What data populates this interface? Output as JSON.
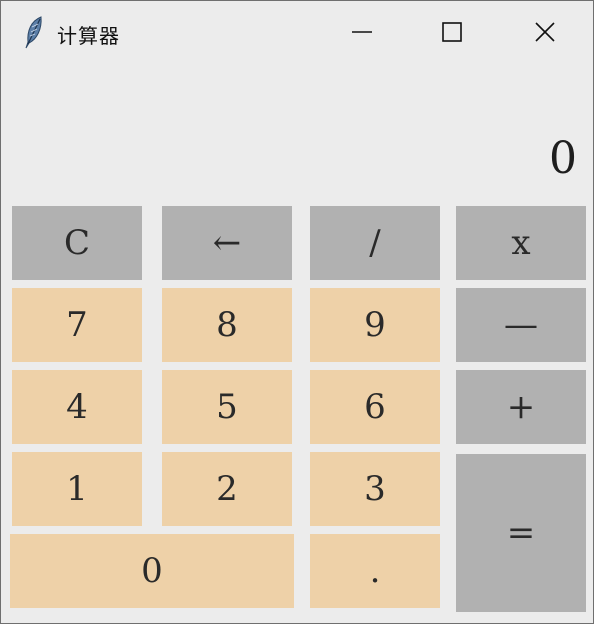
{
  "window": {
    "title": "计算器",
    "app_icon": "feather-icon",
    "controls": {
      "minimize": "minimize-icon",
      "maximize": "maximize-icon",
      "close": "close-icon"
    }
  },
  "display": {
    "value": "0"
  },
  "keys": {
    "clear": "C",
    "backspace": "←",
    "divide": "/",
    "multiply": "x",
    "seven": "7",
    "eight": "8",
    "nine": "9",
    "minus": "—",
    "four": "4",
    "five": "5",
    "six": "6",
    "plus": "+",
    "one": "1",
    "two": "2",
    "three": "3",
    "equals": "=",
    "zero": "0",
    "dot": "."
  },
  "colors": {
    "operator_key": "#b1b1b1",
    "number_key": "#eed1a8",
    "background": "#ececec"
  }
}
